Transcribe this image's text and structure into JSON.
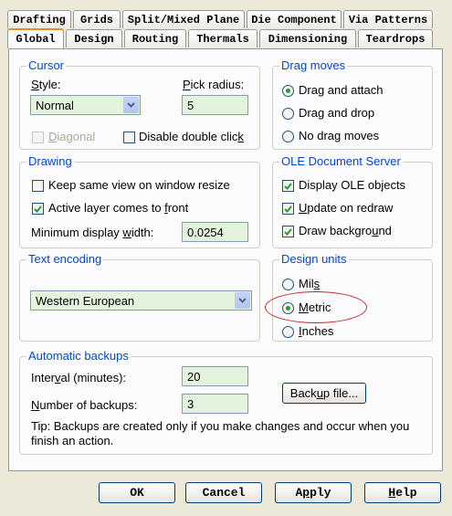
{
  "tabs_row1": [
    "Drafting",
    "Grids",
    "Split/Mixed Plane",
    "Die Component",
    "Via Patterns"
  ],
  "tabs_row2": [
    "Global",
    "Design",
    "Routing",
    "Thermals",
    "Dimensioning",
    "Teardrops"
  ],
  "active_tab": "Global",
  "cursor": {
    "title": "Cursor",
    "style_label": "Style:",
    "style_value": "Normal",
    "pick_radius_label": "Pick radius:",
    "pick_radius_value": "5",
    "diagonal_label": "Diagonal",
    "diagonal_checked": false,
    "diagonal_enabled": false,
    "disable_double_click_label": "Disable double click",
    "disable_double_click_checked": false
  },
  "drag_moves": {
    "title": "Drag moves",
    "options": [
      "Drag and attach",
      "Drag and drop",
      "No drag moves"
    ],
    "selected": "Drag and attach"
  },
  "drawing": {
    "title": "Drawing",
    "keep_view_label": "Keep same view on window resize",
    "keep_view_checked": false,
    "active_layer_label": "Active layer comes to front",
    "active_layer_checked": true,
    "min_width_label": "Minimum display width:",
    "min_width_value": "0.0254"
  },
  "ole": {
    "title": "OLE Document Server",
    "display_label": "Display OLE objects",
    "display_checked": true,
    "update_label": "Update on redraw",
    "update_checked": true,
    "background_label": "Draw background",
    "background_checked": true
  },
  "text_encoding": {
    "title": "Text encoding",
    "value": "Western European"
  },
  "design_units": {
    "title": "Design units",
    "options": [
      "Mils",
      "Metric",
      "Inches"
    ],
    "selected": "Metric"
  },
  "backups": {
    "title": "Automatic backups",
    "interval_label": "Interval (minutes):",
    "interval_value": "20",
    "number_label": "Number of backups:",
    "number_value": "3",
    "backup_file_button": "Backup file...",
    "tip": "Tip: Backups are created only if you make changes and occur when you finish an action."
  },
  "buttons": {
    "ok": "OK",
    "cancel": "Cancel",
    "apply": "Apply",
    "help": "Help"
  },
  "colors": {
    "group_title": "#0046d5",
    "field_bg": "#e3f3dd",
    "annotation": "#c8282a",
    "active_tab_accent": "#e68b2c"
  }
}
